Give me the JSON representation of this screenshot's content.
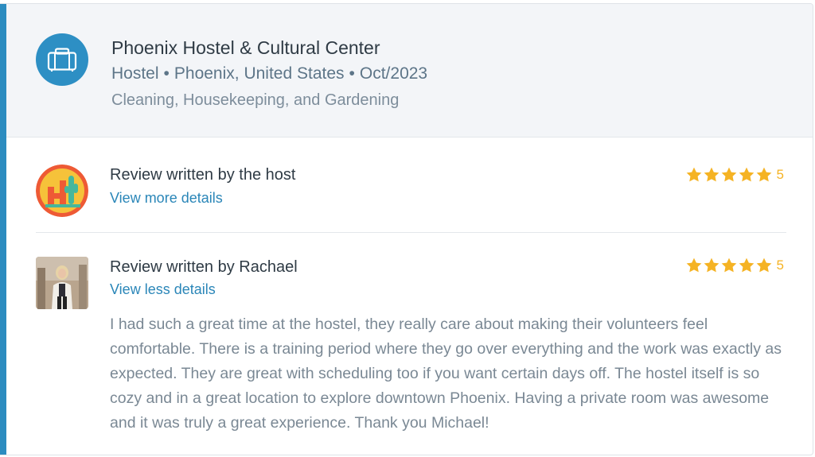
{
  "header": {
    "title": "Phoenix Hostel & Cultural Center",
    "type": "Hostel",
    "location": "Phoenix, United States",
    "date": "Oct/2023",
    "separator": "•",
    "skills": "Cleaning, Housekeeping, and Gardening",
    "icon": "briefcase-icon"
  },
  "reviews": [
    {
      "title": "Review written by the host",
      "link": "View more details",
      "rating": 5,
      "rating_label": "5",
      "avatar": "host-logo-cactus"
    },
    {
      "title": "Review written by Rachael",
      "link": "View less details",
      "rating": 5,
      "rating_label": "5",
      "avatar": "rachael-photo",
      "text": "I had such a great time at the hostel, they really care about making their volunteers feel comfortable. There is a training period where they go over everything and the work was exactly as expected. They are great with scheduling too if you want certain days off. The hostel itself is so cozy and in a great location to explore downtown Phoenix. Having a private room was awesome and it was truly a great experience. Thank you Michael!"
    }
  ],
  "colors": {
    "accent": "#2c8cc0",
    "link": "#2a86b8",
    "star": "#f5b324",
    "header_bg": "#f3f5f8"
  }
}
